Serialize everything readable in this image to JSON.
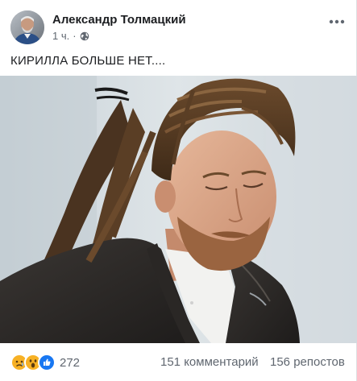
{
  "post": {
    "author": {
      "name": "Александр Толмацкий",
      "avatar_icon": "user-avatar"
    },
    "meta": {
      "time": "1 ч.",
      "separator": "·",
      "audience_icon": "globe-icon"
    },
    "more_icon": "ellipsis-icon",
    "text": "КИРИЛЛА БОЛЬШЕ НЕТ....",
    "photo": {
      "description_icon": "photo"
    }
  },
  "footer": {
    "reactions": {
      "icons": [
        "sad-reaction-icon",
        "wow-reaction-icon",
        "like-reaction-icon"
      ],
      "count": "272"
    },
    "comments": "151 комментарий",
    "shares": "156 репостов"
  },
  "colors": {
    "text_primary": "#1c1e21",
    "text_secondary": "#606770",
    "like_blue": "#1877f2",
    "reaction_yellow": "#f7b125"
  }
}
